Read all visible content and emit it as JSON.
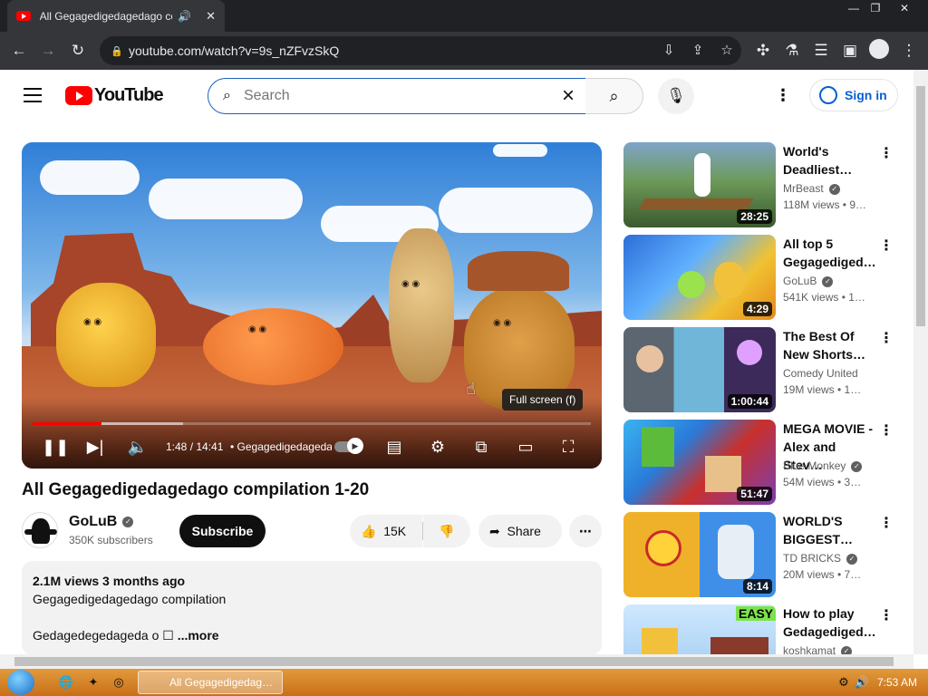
{
  "browser": {
    "tab_title": "All Gegagedigedagedago co",
    "tab_audio_icon": "speaker-icon",
    "url": "youtube.com/watch?v=9s_nZFvzSkQ",
    "window_controls": [
      "—",
      "❐",
      "✕"
    ]
  },
  "header": {
    "logo_text": "YouTube",
    "search_placeholder": "Search",
    "sign_in_label": "Sign in"
  },
  "player": {
    "current_time": "1:48 / 14:41",
    "chapter_text": "• Gegagedigedagedago",
    "tooltip": "Full screen (f)",
    "played_fraction": 0.123,
    "buffered_fraction": 0.27
  },
  "video": {
    "title": "All Gegagedigedagedago compilation 1-20",
    "channel": "GoLuB",
    "subscribers": "350K subscribers",
    "subscribe_label": "Subscribe",
    "likes": "15K",
    "share_label": "Share",
    "stats": "2.1M views  3 months ago",
    "description_line1": "Gegagedigedagedago compilation",
    "description_line2": "Gedagedegedageda o ☐ ",
    "more_label": "...more"
  },
  "recommendations": [
    {
      "title": "World's Deadliest…",
      "channel": "MrBeast",
      "meta": "118M views  • 9…",
      "duration": "28:25",
      "verified": true
    },
    {
      "title": "All top 5 Gegagediged…",
      "channel": "GoLuB",
      "meta": "541K views  • 1…",
      "duration": "4:29",
      "verified": true
    },
    {
      "title": "The Best Of New Shorts…",
      "channel": "Comedy United",
      "meta": "19M views  • 1…",
      "duration": "1:00:44",
      "verified": false
    },
    {
      "title": "MEGA MOVIE - Alex and Stev…",
      "channel": "Blue Monkey",
      "meta": "54M views  • 3…",
      "duration": "51:47",
      "verified": true
    },
    {
      "title": "WORLD'S BIGGEST…",
      "channel": "TD BRICKS",
      "meta": "20M views  • 7…",
      "duration": "8:14",
      "verified": true
    },
    {
      "title": "How to play Gedagediged…",
      "channel": "koshkamat",
      "meta": "",
      "duration": "",
      "verified": true
    }
  ],
  "taskbar": {
    "task_label": "All Gegagedigedag…",
    "clock": "7:53 AM"
  },
  "colors": {
    "youtube_red": "#ff0000",
    "link_blue": "#065fd4",
    "chrome_dark": "#202124",
    "taskbar_orange": "#d9842a"
  }
}
